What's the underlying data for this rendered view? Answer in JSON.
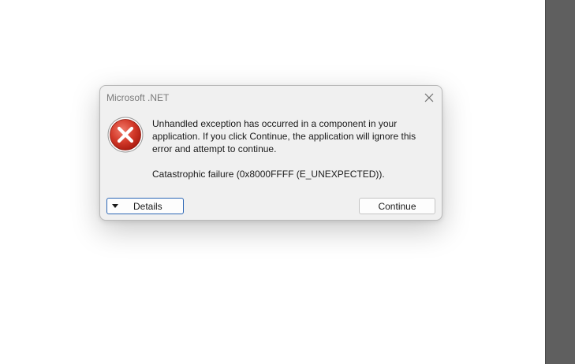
{
  "dialog": {
    "title": "Microsoft .NET",
    "close_icon": "close-icon",
    "error_icon": "error-x-icon",
    "message_lines": [
      "Unhandled exception has occurred in a component in your",
      "application. If you click Continue, the application will ignore this",
      "error and attempt to continue."
    ],
    "error_detail": "Catastrophic failure (0x8000FFFF (E_UNEXPECTED)).",
    "details_label": "Details",
    "continue_label": "Continue",
    "colors": {
      "error_red": "#c42b1c",
      "focus_blue": "#2b66b5",
      "right_panel": "#5f5f5f"
    }
  }
}
